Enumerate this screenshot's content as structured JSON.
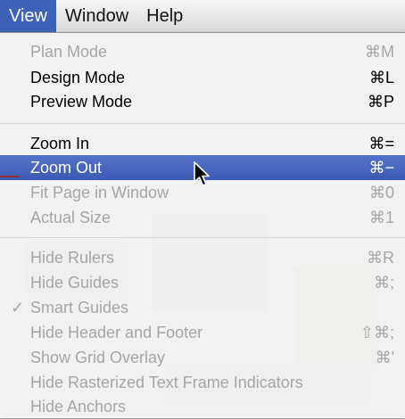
{
  "menubar": {
    "items": [
      {
        "label": "View",
        "active": true
      },
      {
        "label": "Window",
        "active": false
      },
      {
        "label": "Help",
        "active": false
      }
    ]
  },
  "menu": {
    "items": [
      {
        "label": "Plan Mode",
        "shortcut": "⌘M",
        "enabled": false
      },
      {
        "label": "Design Mode",
        "shortcut": "⌘L",
        "enabled": true
      },
      {
        "label": "Preview Mode",
        "shortcut": "⌘P",
        "enabled": true
      },
      {
        "label": "Zoom In",
        "shortcut": "⌘=",
        "enabled": true
      },
      {
        "label": "Zoom Out",
        "shortcut": "⌘−",
        "enabled": true,
        "highlighted": true
      },
      {
        "label": "Fit Page in Window",
        "shortcut": "⌘0",
        "enabled": false
      },
      {
        "label": "Actual Size",
        "shortcut": "⌘1",
        "enabled": false
      },
      {
        "label": "Hide Rulers",
        "shortcut": "⌘R",
        "enabled": false
      },
      {
        "label": "Hide Guides",
        "shortcut": "⌘;",
        "enabled": false
      },
      {
        "label": "Smart Guides",
        "shortcut": "",
        "enabled": false,
        "checked": true,
        "check_mark": "✓"
      },
      {
        "label": "Hide Header and Footer",
        "shortcut": "⇧⌘;",
        "enabled": false
      },
      {
        "label": "Show Grid Overlay",
        "shortcut": "⌘'",
        "enabled": false
      },
      {
        "label": "Hide Rasterized Text Frame Indicators",
        "shortcut": "",
        "enabled": false
      },
      {
        "label": "Hide Anchors",
        "shortcut": "",
        "enabled": false
      }
    ]
  },
  "colors": {
    "menu_highlight": "#3d63b8",
    "disabled_text": "#a7a7a7",
    "callout_line": "#8e2f38"
  }
}
